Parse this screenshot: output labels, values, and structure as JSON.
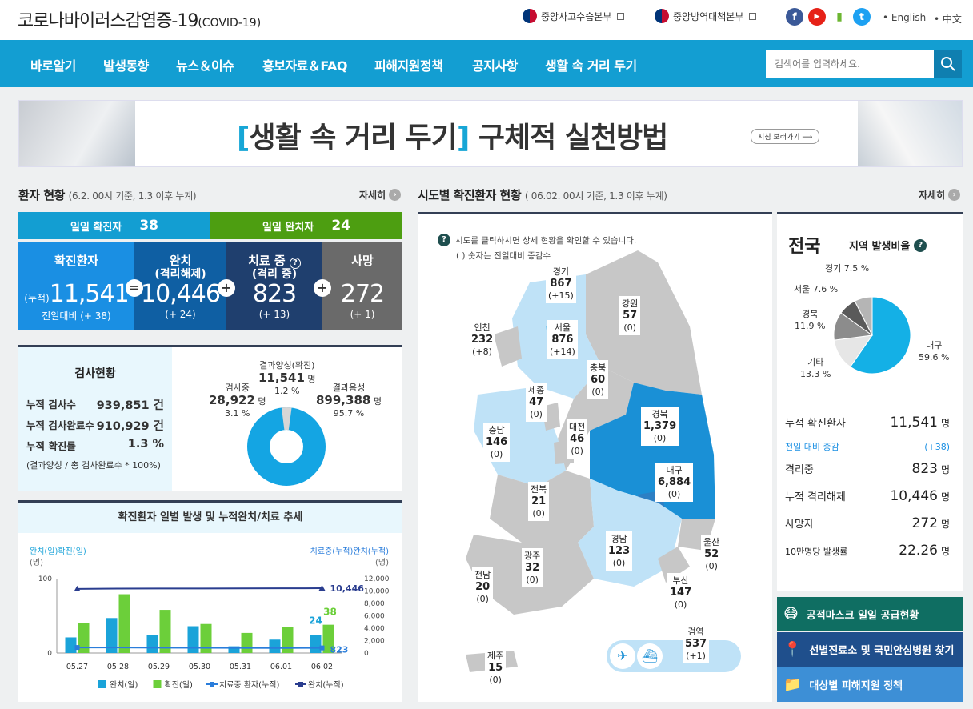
{
  "header": {
    "title": "코로나바이러스감염증-19",
    "title_suffix": "(COVID-19)",
    "links": [
      "중앙사고수습본부",
      "중앙방역대책본부"
    ],
    "sns": [
      "f",
      "▶",
      "▮",
      "t"
    ],
    "langs": [
      "English",
      "中文"
    ]
  },
  "nav": {
    "items": [
      "바로알기",
      "발생동향",
      "뉴스＆이슈",
      "홍보자료＆FAQ",
      "피해지원정책",
      "공지사항",
      "생활 속 거리 두기"
    ],
    "search_placeholder": "검색어를 입력하세요."
  },
  "banner": {
    "bracket_l": "[",
    "highlight": "생활 속 거리 두기",
    "bracket_r": "]",
    "rest": "구체적 실천방법",
    "button": "지침 보러가기 ⟶"
  },
  "patients": {
    "title": "환자 현황",
    "subtitle": "(6.2. 00시 기준, 1.3 이후 누계)",
    "more": "자세히",
    "daily": [
      {
        "label": "일일 확진자",
        "value": "38",
        "color": "#139ed2"
      },
      {
        "label": "일일 완치자",
        "value": "24",
        "color": "#4d9e11"
      }
    ],
    "stats": [
      {
        "head": "확진환자",
        "sub": "",
        "prefix": "(누적)",
        "value": "11,541",
        "diff": "전일대비 (+ 38)",
        "color": "#1a8fe3"
      },
      {
        "head": "완치",
        "sub": "(격리해제)",
        "prefix": "",
        "value": "10,446",
        "diff": "(+ 24)",
        "color": "#0f5fa3"
      },
      {
        "head": "치료 중",
        "sub": "(격리 중)",
        "prefix": "",
        "value": "823",
        "diff": "(+ 13)",
        "color": "#1f3f6e"
      },
      {
        "head": "사망",
        "sub": "",
        "prefix": "",
        "value": "272",
        "diff": "(+ 1)",
        "color": "#6a6a6a"
      }
    ],
    "ops": [
      "=",
      "+",
      "+"
    ]
  },
  "tests": {
    "title": "검사현황",
    "rows": [
      {
        "label": "누적 검사수",
        "value": "939,851 건"
      },
      {
        "label": "누적 검사완료수",
        "value": "910,929 건"
      },
      {
        "label": "누적 확진률",
        "value": "1.3 %"
      }
    ],
    "note": "(결과양성 / 총 검사완료수 * 100%)",
    "donut": {
      "positive": {
        "label": "결과양성(확진)",
        "value": "11,541",
        "unit": "명",
        "pct": "1.2 %",
        "frac": 1.2
      },
      "testing": {
        "label": "검사중",
        "value": "28,922",
        "unit": "명",
        "pct": "3.1 %",
        "frac": 3.1
      },
      "negative": {
        "label": "결과음성",
        "value": "899,388",
        "unit": "명",
        "pct": "95.7 %",
        "frac": 95.7
      }
    }
  },
  "trend_title": "확진환자 일별 발생 및 누적완치/치료 추세",
  "chart_data": {
    "type": "bar",
    "title": "확진환자 일별 발생 및 누적완치/치료 추세",
    "categories": [
      "05.27",
      "05.28",
      "05.29",
      "05.30",
      "05.31",
      "06.01",
      "06.02"
    ],
    "left_axis": {
      "label": "완치(일)확진(일)",
      "unit": "(명)",
      "ticks": [
        "100",
        "0"
      ],
      "range": [
        0,
        100
      ]
    },
    "right_axis": {
      "label": "치료중(누적)완치(누적)",
      "unit": "(명)",
      "ticks": [
        "12,000",
        "10,000",
        "8,000",
        "6,000",
        "4,000",
        "2,000",
        "0"
      ],
      "range": [
        0,
        12000
      ]
    },
    "series": [
      {
        "name": "완치(일)",
        "kind": "bar",
        "axis": "left",
        "color": "#1aa3d9",
        "values": [
          21,
          47,
          24,
          36,
          9,
          18,
          24
        ]
      },
      {
        "name": "확진(일)",
        "kind": "bar",
        "axis": "left",
        "color": "#6ccf3a",
        "values": [
          40,
          79,
          58,
          39,
          27,
          35,
          38
        ]
      },
      {
        "name": "치료중 환자(누적)",
        "kind": "line",
        "axis": "right",
        "color": "#2a7ddb",
        "values": [
          890,
          880,
          860,
          840,
          830,
          810,
          823
        ]
      },
      {
        "name": "완치(누적)",
        "kind": "line",
        "axis": "right",
        "color": "#2a3d8f",
        "values": [
          10340,
          10380,
          10400,
          10410,
          10420,
          10430,
          10446
        ]
      }
    ],
    "annotations": [
      "10,446",
      "823",
      "24",
      "38"
    ]
  },
  "map": {
    "title": "시도별 확진환자 현황",
    "subtitle": "( 06.02. 00시 기준, 1.3 이후 누계)",
    "more": "자세히",
    "help": "시도를 클릭하시면 상세 현황을 확인할 수 있습니다.",
    "help2": "( ) 숫자는 전일대비 증감수",
    "regions": [
      {
        "name": "경기",
        "value": "867",
        "diff": "(+15)"
      },
      {
        "name": "강원",
        "value": "57",
        "diff": "(0)"
      },
      {
        "name": "인천",
        "value": "232",
        "diff": "(+8)"
      },
      {
        "name": "서울",
        "value": "876",
        "diff": "(+14)"
      },
      {
        "name": "충북",
        "value": "60",
        "diff": "(0)"
      },
      {
        "name": "세종",
        "value": "47",
        "diff": "(0)"
      },
      {
        "name": "경북",
        "value": "1,379",
        "diff": "(0)"
      },
      {
        "name": "대전",
        "value": "46",
        "diff": "(0)"
      },
      {
        "name": "충남",
        "value": "146",
        "diff": "(0)"
      },
      {
        "name": "대구",
        "value": "6,884",
        "diff": "(0)"
      },
      {
        "name": "전북",
        "value": "21",
        "diff": "(0)"
      },
      {
        "name": "울산",
        "value": "52",
        "diff": "(0)"
      },
      {
        "name": "경남",
        "value": "123",
        "diff": "(0)"
      },
      {
        "name": "광주",
        "value": "32",
        "diff": "(0)"
      },
      {
        "name": "전남",
        "value": "20",
        "diff": "(0)"
      },
      {
        "name": "부산",
        "value": "147",
        "diff": "(0)"
      },
      {
        "name": "검역",
        "value": "537",
        "diff": "(+1)"
      },
      {
        "name": "제주",
        "value": "15",
        "diff": "(0)"
      }
    ]
  },
  "national": {
    "title": "전국",
    "ratio_label": "지역 발생비율",
    "pie": [
      {
        "name": "대구",
        "pct": "59.6 %",
        "value": 59.6,
        "color": "#14b0e6"
      },
      {
        "name": "기타",
        "pct": "13.3 %",
        "value": 13.3,
        "color": "#e6e6e6"
      },
      {
        "name": "경북",
        "pct": "11.9 %",
        "value": 11.9,
        "color": "#8c8c8c"
      },
      {
        "name": "서울",
        "pct": "7.6 %",
        "value": 7.6,
        "color": "#5a5a5a"
      },
      {
        "name": "경기",
        "pct": "7.5 %",
        "value": 7.5,
        "color": "#b5b5b5"
      }
    ],
    "rows": [
      {
        "label": "누적 확진환자",
        "value": "11,541",
        "unit": "명"
      },
      {
        "label": "전일 대비 증감",
        "value": "(+38)",
        "unit": ""
      },
      {
        "label": "격리중",
        "value": "823",
        "unit": "명"
      },
      {
        "label": "누적 격리해제",
        "value": "10,446",
        "unit": "명"
      },
      {
        "label": "사망자",
        "value": "272",
        "unit": "명"
      },
      {
        "label": "10만명당 발생률",
        "value": "22.26",
        "unit": "명"
      }
    ]
  },
  "quick": [
    {
      "label": "공적마스크 일일 공급현황",
      "color": "#0f6e62"
    },
    {
      "label": "선별진료소 및 국민안심병원 찾기",
      "color": "#1f4f8c"
    },
    {
      "label": "대상별 피해지원 정책",
      "color": "#3d8fd6"
    }
  ],
  "colors": {
    "nav": "#139ed2",
    "map_dark": "#1a90d6",
    "map_mid": "#7ec8ee",
    "map_light": "#bfe2f7",
    "map_gray": "#c7c7c7"
  }
}
